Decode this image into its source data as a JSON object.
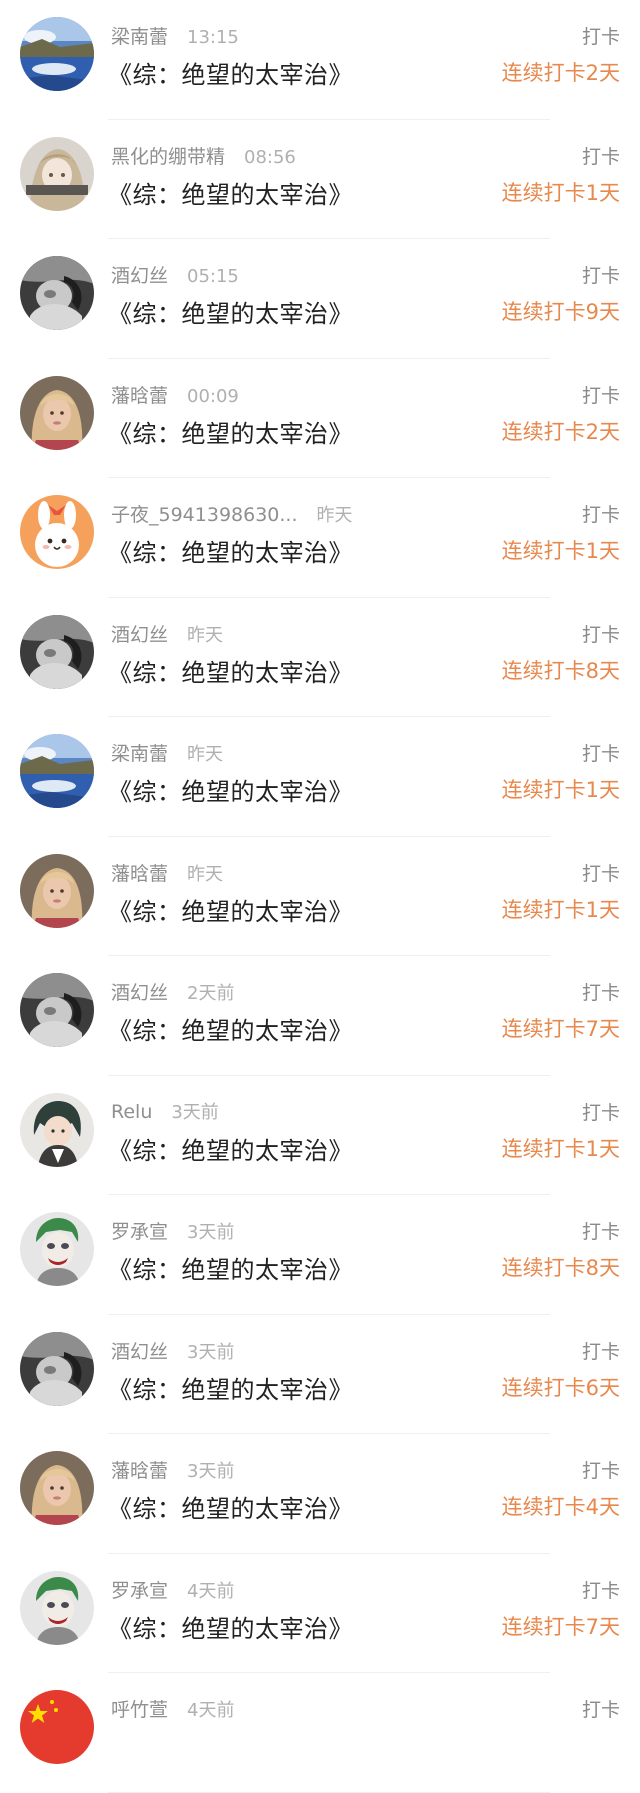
{
  "rows": [
    {
      "name": "梁南蕾",
      "time": "13:15",
      "title": "《综：绝望的太宰治》",
      "action": "打卡",
      "streak": "连续打卡2天",
      "avatar": "lake-photo-avatar"
    },
    {
      "name": "黑化的绷带精",
      "time": "08:56",
      "title": "《综：绝望的太宰治》",
      "action": "打卡",
      "streak": "连续打卡1天",
      "avatar": "anime-girl-avatar"
    },
    {
      "name": "酒幻丝",
      "time": "05:15",
      "title": "《综：绝望的太宰治》",
      "action": "打卡",
      "streak": "连续打卡9天",
      "avatar": "bw-portrait-avatar"
    },
    {
      "name": "藩晗蕾",
      "time": "00:09",
      "title": "《综：绝望的太宰治》",
      "action": "打卡",
      "streak": "连续打卡2天",
      "avatar": "blonde-girl-avatar"
    },
    {
      "name": "子夜_5941398630...",
      "time": "昨天",
      "title": "《综：绝望的太宰治》",
      "action": "打卡",
      "streak": "连续打卡1天",
      "avatar": "cartoon-bunny-avatar"
    },
    {
      "name": "酒幻丝",
      "time": "昨天",
      "title": "《综：绝望的太宰治》",
      "action": "打卡",
      "streak": "连续打卡8天",
      "avatar": "bw-portrait-avatar"
    },
    {
      "name": "梁南蕾",
      "time": "昨天",
      "title": "《综：绝望的太宰治》",
      "action": "打卡",
      "streak": "连续打卡1天",
      "avatar": "lake-photo-avatar"
    },
    {
      "name": "藩晗蕾",
      "time": "昨天",
      "title": "《综：绝望的太宰治》",
      "action": "打卡",
      "streak": "连续打卡1天",
      "avatar": "blonde-girl-avatar"
    },
    {
      "name": "酒幻丝",
      "time": "2天前",
      "title": "《综：绝望的太宰治》",
      "action": "打卡",
      "streak": "连续打卡7天",
      "avatar": "bw-portrait-avatar"
    },
    {
      "name": "Relu",
      "time": "3天前",
      "title": "《综：绝望的太宰治》",
      "action": "打卡",
      "streak": "连续打卡1天",
      "avatar": "anime-boy-avatar"
    },
    {
      "name": "罗承宣",
      "time": "3天前",
      "title": "《综：绝望的太宰治》",
      "action": "打卡",
      "streak": "连续打卡8天",
      "avatar": "joker-avatar"
    },
    {
      "name": "酒幻丝",
      "time": "3天前",
      "title": "《综：绝望的太宰治》",
      "action": "打卡",
      "streak": "连续打卡6天",
      "avatar": "bw-portrait-avatar"
    },
    {
      "name": "藩晗蕾",
      "time": "3天前",
      "title": "《综：绝望的太宰治》",
      "action": "打卡",
      "streak": "连续打卡4天",
      "avatar": "blonde-girl-avatar"
    },
    {
      "name": "罗承宣",
      "time": "4天前",
      "title": "《综：绝望的太宰治》",
      "action": "打卡",
      "streak": "连续打卡7天",
      "avatar": "joker-avatar"
    },
    {
      "name": "呼竹萱",
      "time": "4天前",
      "title": "",
      "action": "打卡",
      "streak": "",
      "avatar": "flag-avatar"
    }
  ],
  "colors": {
    "streak": "#e7884d",
    "name": "#8f8f8f",
    "time": "#b0b0b0",
    "title": "#222222",
    "action": "#8a8a8a",
    "divider": "#efefef"
  }
}
